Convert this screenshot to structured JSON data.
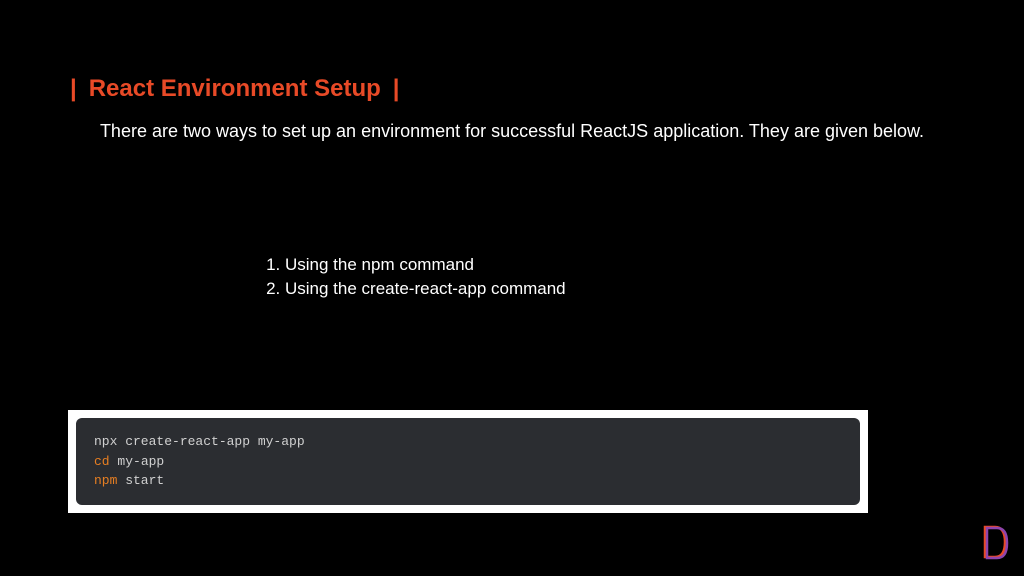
{
  "title": {
    "bar_left": "|",
    "text": "React Environment Setup",
    "bar_right": "|"
  },
  "intro": "There are two ways to set up an environment for successful ReactJS application. They are given below.",
  "list": {
    "item1": "Using the npm command",
    "item2": "Using the create-react-app command"
  },
  "code": {
    "line1_cmd": "npx",
    "line1_rest": " create-react-app my-app",
    "line2_cmd": "cd",
    "line2_rest": " my-app",
    "line3_cmd": "npm",
    "line3_rest": " start"
  }
}
